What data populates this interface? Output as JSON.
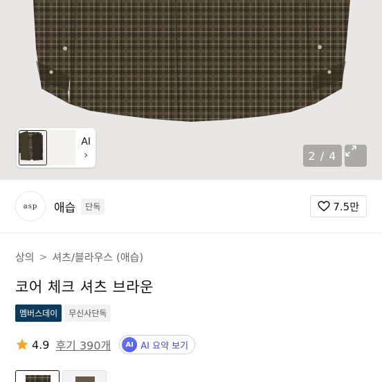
{
  "gallery": {
    "thumbnail_ai_label": "AI",
    "page_indicator": "2 / 4"
  },
  "brand": {
    "logo_text": "asp",
    "name": "애습",
    "tag": "단독",
    "likes": "7.5만"
  },
  "breadcrumb": {
    "level1": "상의",
    "separator": ">",
    "level2": "셔츠/블라우스 (애습)"
  },
  "product": {
    "title": "코어 체크 셔츠 브라운",
    "badges": [
      "멤버스데이",
      "무신사단독"
    ],
    "rating": "4.9",
    "reviews": "후기 390개",
    "ai_summary_icon": "AI",
    "ai_summary_label": "AI 요약 보기"
  },
  "colors": {
    "accent_member_badge": "#0c3a5c",
    "ai_accent": "#3c4ad8",
    "star": "#f5a623"
  }
}
